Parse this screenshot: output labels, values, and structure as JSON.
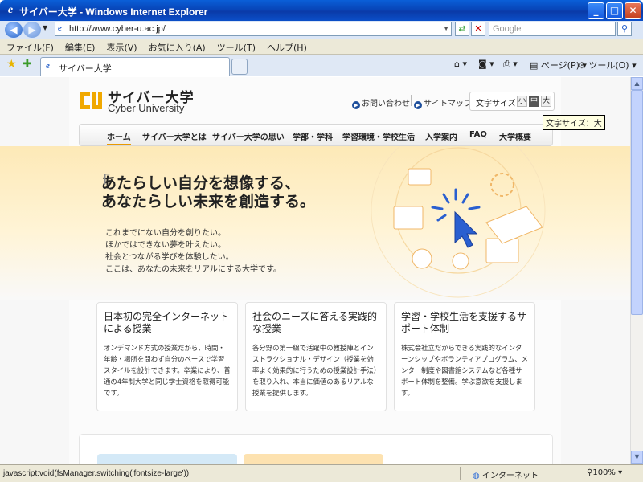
{
  "window": {
    "title": "サイバー大学 - Windows Internet Explorer"
  },
  "browser": {
    "url": "http://www.cyber-u.ac.jp/",
    "search_placeholder": "Google",
    "menu": [
      "ファイル(F)",
      "編集(E)",
      "表示(V)",
      "お気に入り(A)",
      "ツール(T)",
      "ヘルプ(H)"
    ],
    "tab_title": "サイバー大学",
    "toolbar": {
      "page_label": "ページ(P)",
      "tools_label": "ツール(O)"
    }
  },
  "site": {
    "logo_jp": "サイバー大学",
    "logo_en": "Cyber University",
    "contact": "お問い合わせ",
    "sitemap": "サイトマップ",
    "fontsize_label": "文字サイズ",
    "fontsize_small": "小",
    "fontsize_medium": "中",
    "fontsize_large": "大",
    "tooltip": "文字サイズ：大",
    "nav": [
      "ホーム",
      "サイバー大学とは",
      "サイバー大学の思い",
      "学部・学科",
      "学習環境・学校生活",
      "入学案内",
      "FAQ",
      "大学概要"
    ],
    "hero_line1": "あたらしい自分を想像する、",
    "hero_line2": "あなたらしい未来を創造する。",
    "hero_body": [
      "これまでにない自分を創りたい。",
      "ほかではできない夢を叶えたい。",
      "社会とつながる学びを体験したい。",
      "ここは、あなたの未来をリアルにする大学です。"
    ],
    "cards": [
      {
        "title": "日本初の完全インターネットによる授業",
        "text": "オンデマンド方式の授業だから、時間・年齢・場所を問わず自分のペースで学習スタイルを設計できます。卒業により、普通の4年制大学と同じ学士資格を取得可能です。"
      },
      {
        "title": "社会のニーズに答える実践的な授業",
        "text": "各分野の第一線で活躍中の教授陣とインストラクショナル・デザイン（授業を効率よく効果的に行うための授業設計手法）を取り入れ、本当に価値のあるリアルな授業を提供します。"
      },
      {
        "title": "学習・学校生活を支援するサポート体制",
        "text": "株式会社立だからできる実践的なインターンシップやボランティアプログラム、メンター制度や図書館システムなど各種サポート体制を整備。学ぶ意欲を支援します。"
      }
    ]
  },
  "status": {
    "text": "javascript:void(fsManager.switching('fontsize-large'))",
    "zone": "インターネット",
    "zoom": "100%"
  },
  "colors": {
    "accent": "#f0a800",
    "nav_active": "#e99a00",
    "title_blue": "#0a4fc8"
  }
}
